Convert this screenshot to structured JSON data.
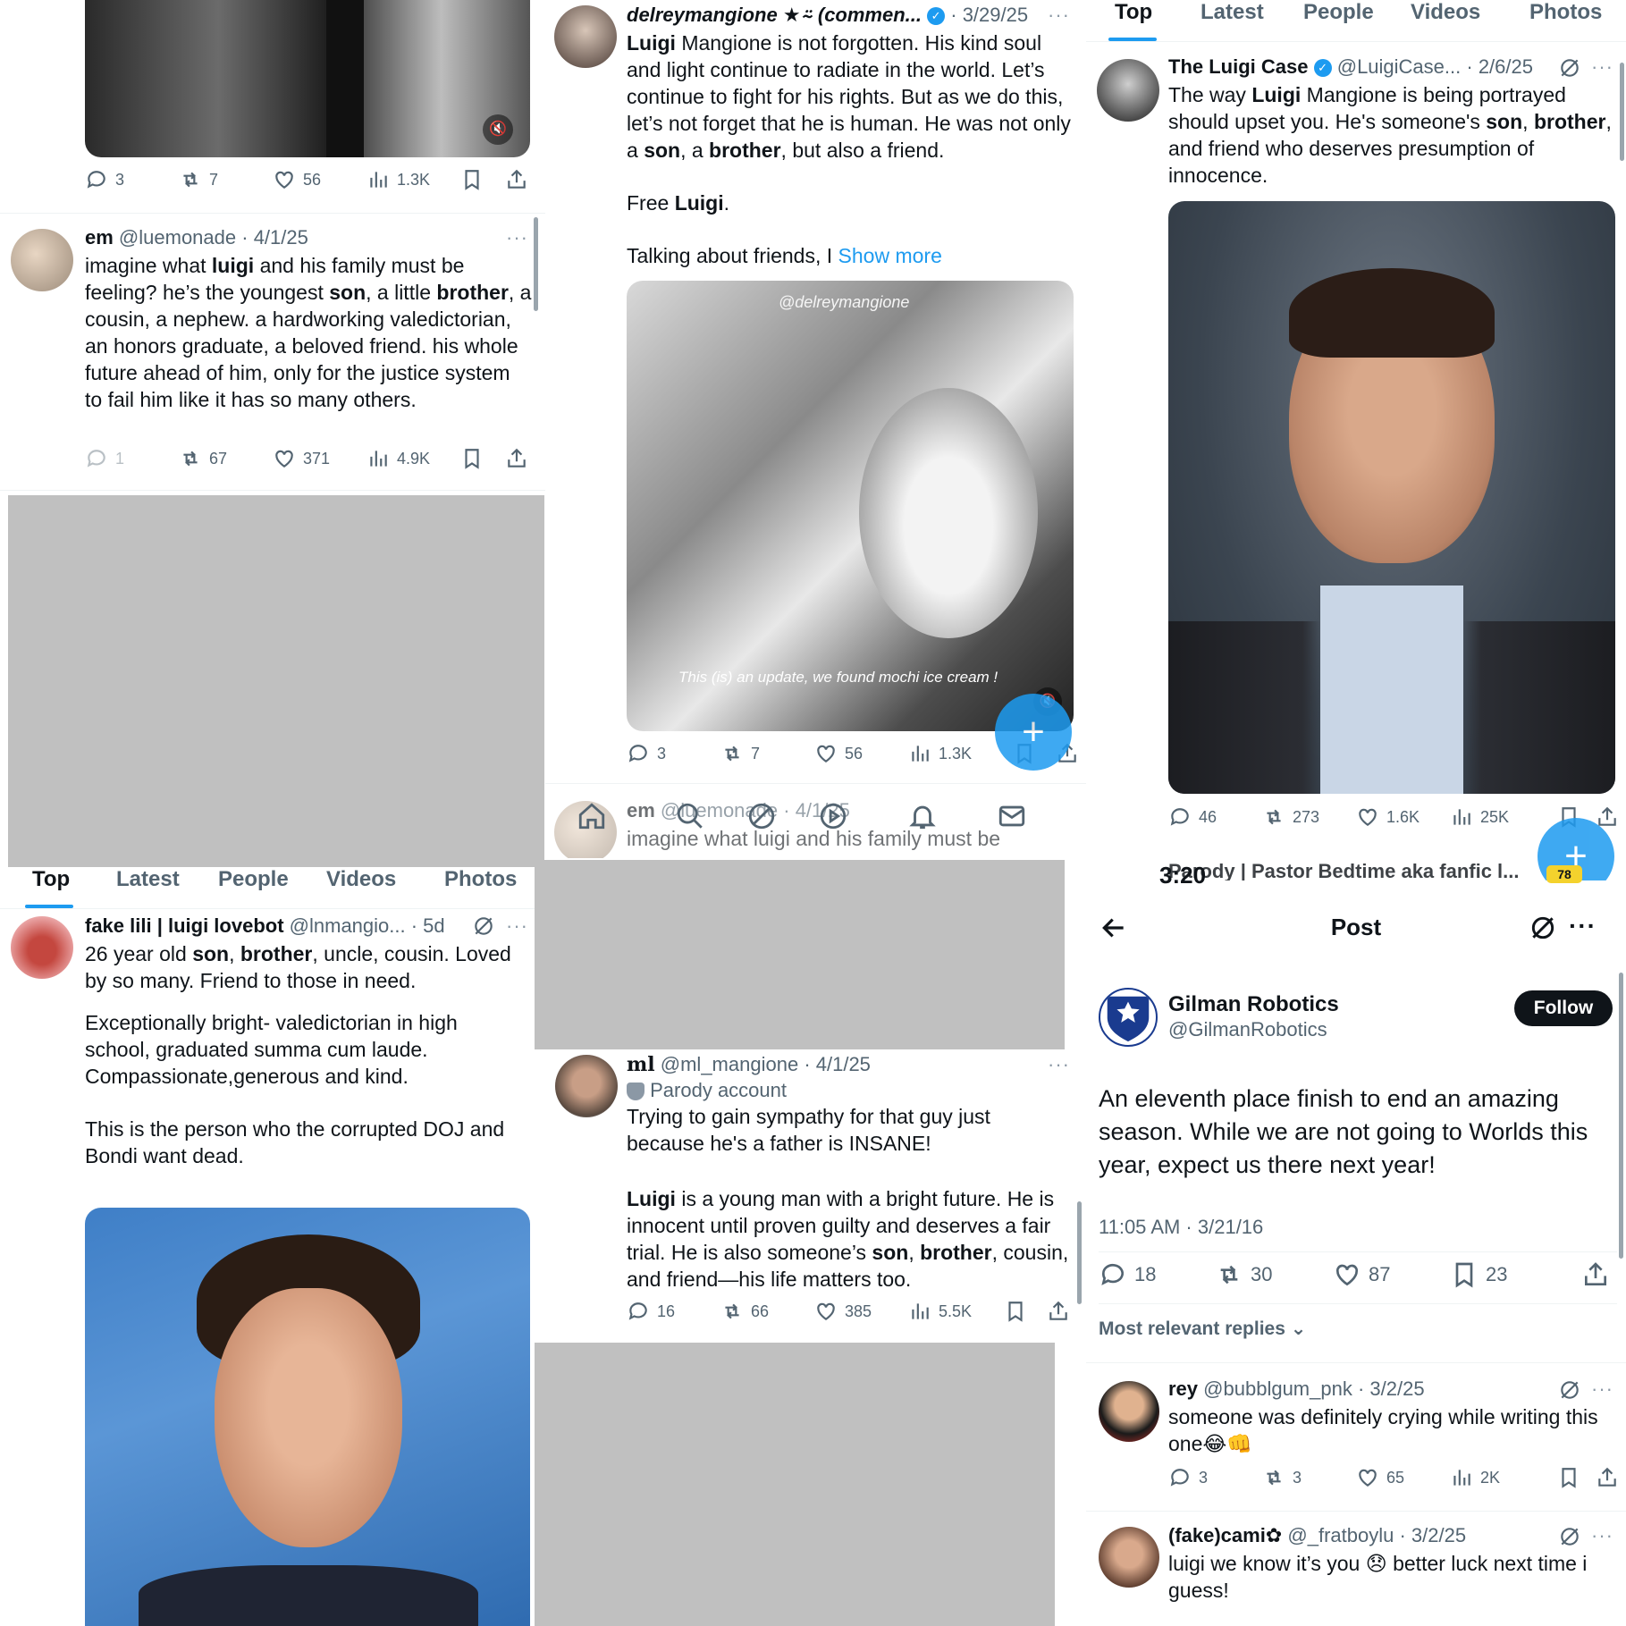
{
  "p1": {
    "video_actions": {
      "replies": "3",
      "reposts": "7",
      "likes": "56",
      "views": "1.3K"
    },
    "tweet": {
      "name": "em",
      "handle": "@luemonade",
      "date": "· 4/1/25",
      "text": "imagine what luigi and his family must be feeling? he’s the youngest son, a little brother, a cousin, a nephew. a hardworking valedictorian, an honors graduate, a beloved friend. his whole future ahead of him, only for the justice system to fail him like it has so many others.",
      "bold_words": [
        "luigi",
        "son",
        "brother"
      ],
      "replies": "1",
      "reposts": "67",
      "likes": "371",
      "views": "4.9K"
    }
  },
  "p2": {
    "tweet": {
      "name": "delreymangione ★⍨ (commen...",
      "date": "· 3/29/25",
      "text_p1": "Luigi Mangione is not forgotten. His kind soul and light continue to radiate in the world. Let’s continue to fight for his rights. But as we do this, let’s not forget that he is human. He was not only a son, a brother, but also a friend.",
      "text_p2": "Free Luigi.",
      "text_p3": "Talking about friends, I",
      "show_more": "Show more",
      "watermark": "@delreymangione",
      "caption": "This (is) an update, we found mochi ice cream !",
      "replies": "3",
      "reposts": "7",
      "likes": "56",
      "views": "1.3K"
    },
    "next_tweet": {
      "name": "em",
      "handle": "@luemonade",
      "date": "· 4/1/25",
      "text": "imagine what luigi and his family must be"
    }
  },
  "p3": {
    "tabs": [
      "Top",
      "Latest",
      "People",
      "Videos",
      "Photos"
    ],
    "tweet": {
      "name": "The Luigi Case",
      "handle": "@LuigiCase...",
      "date": "· 2/6/25",
      "text": "The way Luigi Mangione is being portrayed should upset you. He's someone's son, brother, and friend who deserves presumption of innocence.",
      "replies": "46",
      "reposts": "273",
      "likes": "1.6K",
      "views": "25K"
    },
    "cutoff_text": "Parody | Pastor Bedtime aka fanfic l..."
  },
  "p4": {
    "tabs": [
      "Top",
      "Latest",
      "People",
      "Videos",
      "Photos"
    ],
    "tweet": {
      "name": "fake lili | luigi lovebot",
      "handle": "@lnmangio...",
      "date": "· 5d",
      "p1": "26 year old son, brother, uncle, cousin. Loved by so many. Friend to those in need.",
      "p2": "Exceptionally bright- valedictorian in high school, graduated summa cum laude.",
      "p3": "Compassionate,generous and kind.",
      "p4": "This is the person who the corrupted DOJ and Bondi want dead."
    }
  },
  "p5": {
    "tweet": {
      "name": "ml",
      "handle": "@ml_mangione",
      "date": "· 4/1/25",
      "badge": "Parody account",
      "p1": "Trying to gain sympathy for that guy just because he's a father is INSANE!",
      "p2": "Luigi is a young man with a bright future. He is innocent until proven guilty and deserves a fair trial. He is also someone’s son, brother, cousin, and friend—his life matters too.",
      "replies": "16",
      "reposts": "66",
      "likes": "385",
      "views": "5.5K"
    }
  },
  "p6": {
    "status_time": "3:20",
    "battery": "78",
    "header_title": "Post",
    "account": {
      "name": "Gilman Robotics",
      "handle": "@GilmanRobotics",
      "follow": "Follow"
    },
    "text": "An eleventh place finish to end an amazing season. While we are not going to Worlds this year, expect us there next year!",
    "timestamp": "11:05 AM · 3/21/16",
    "replies": "18",
    "reposts": "30",
    "likes": "87",
    "bookmarks": "23",
    "sort_label": "Most relevant replies",
    "reply1": {
      "name": "rey",
      "handle": "@bubblgum_pnk",
      "date": "· 3/2/25",
      "text": "someone was definitely crying while writing this one😂👊",
      "replies": "3",
      "reposts": "3",
      "likes": "65",
      "views": "2K"
    },
    "reply2": {
      "name": "(fake)cami✿",
      "handle": "@_fratboylu",
      "date": "· 3/2/25",
      "text": "luigi we know it’s you 😞 better luck next time i guess!"
    }
  },
  "colors": {
    "accent": "#1d9bf0",
    "text": "#0f1419",
    "muted": "#536471",
    "redact": "#c0c0c0"
  }
}
